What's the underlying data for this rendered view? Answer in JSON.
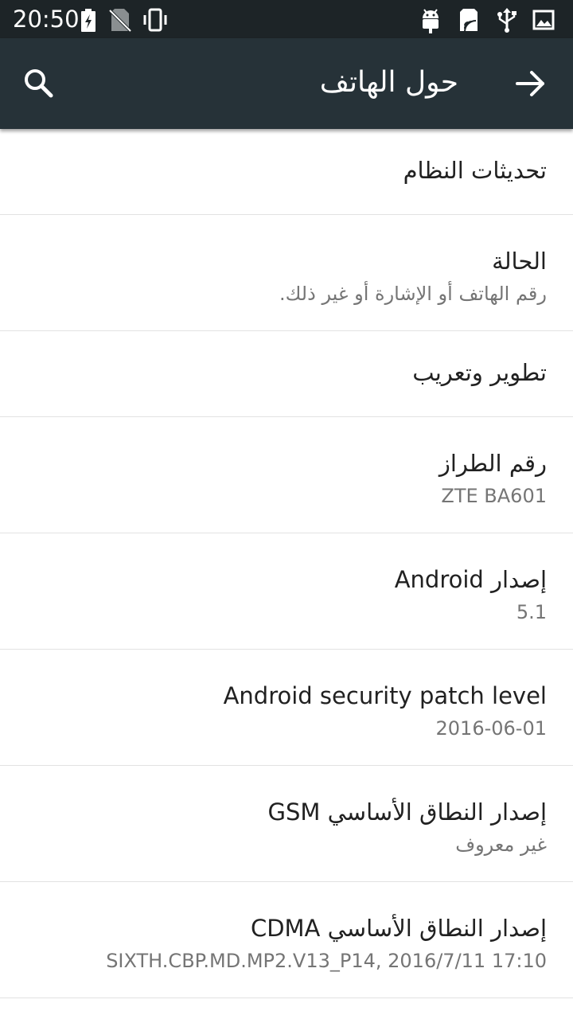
{
  "status_bar": {
    "time": "20:50",
    "icons_left": [
      "battery-charging-icon",
      "no-sim-icon",
      "vibrate-icon"
    ],
    "icons_right": [
      "android-debug-icon",
      "sim-card-icon",
      "usb-icon",
      "image-icon"
    ]
  },
  "app_bar": {
    "title": "حول الهاتف",
    "back_icon": "arrow-forward-icon",
    "search_icon": "search-icon"
  },
  "colors": {
    "status_bar": "#1d2427",
    "app_bar": "#263238",
    "title_text": "#212121",
    "summary_text": "#757575",
    "divider": "#e2e2e2"
  },
  "items": [
    {
      "title": "تحديثات النظام",
      "summary": ""
    },
    {
      "title": "الحالة",
      "summary": "رقم الهاتف أو الإشارة أو غير ذلك."
    },
    {
      "title": "تطوير وتعريب",
      "summary": ""
    },
    {
      "title": "رقم الطراز",
      "summary": "ZTE BA601"
    },
    {
      "title": "إصدار Android",
      "summary": "5.1"
    },
    {
      "title": "Android security patch level",
      "summary": "2016-06-01"
    },
    {
      "title": "إصدار النطاق الأساسي GSM",
      "summary": "غير معروف"
    },
    {
      "title": "إصدار النطاق الأساسي CDMA",
      "summary": "SIXTH.CBP.MD.MP2.V13_P14, 2016/7/11 17:10"
    }
  ]
}
